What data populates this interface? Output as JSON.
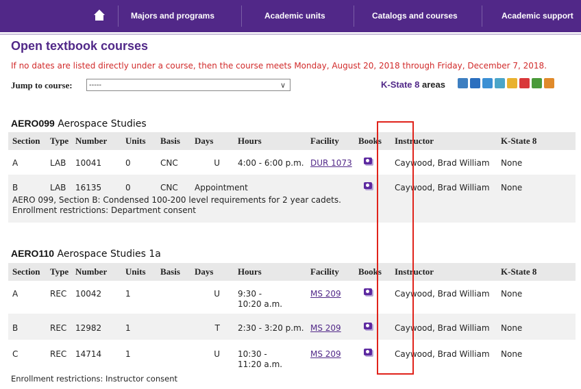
{
  "nav": {
    "items": [
      "Majors and programs",
      "Academic units",
      "Catalogs and courses",
      "Academic support"
    ],
    "home_icon": "home-icon",
    "bg_color": "#512888"
  },
  "page": {
    "title": "Open textbook courses",
    "notice": "If no dates are listed directly under a course, then the course meets Monday, August 20, 2018 through Friday, December 7, 2018.",
    "notice_color": "#d12a2a"
  },
  "jump": {
    "label": "Jump to course:",
    "selected": "-----"
  },
  "k8": {
    "label_brand": "K-State 8",
    "label_rest": " areas",
    "icons": [
      "aesthetic-icon",
      "empirical-icon",
      "ethical-icon",
      "global-icon",
      "historical-icon",
      "human-diversity-icon",
      "natural-physical-icon",
      "social-icon"
    ]
  },
  "columns": [
    "Section",
    "Type",
    "Number",
    "Units",
    "Basis",
    "Days",
    "Hours",
    "Facility",
    "Books",
    "Instructor",
    "K-State 8"
  ],
  "courses": [
    {
      "code": "AERO099",
      "name": "Aerospace Studies",
      "rows": [
        {
          "section": "A",
          "type": "LAB",
          "number": "10041",
          "units": "0",
          "basis": "CNC",
          "days": "U",
          "hours": "4:00 - 6:00 p.m.",
          "hours2": "",
          "facility": "DUR 1073",
          "instructor": "Caywood, Brad William",
          "k8": "None"
        },
        {
          "section": "B",
          "type": "LAB",
          "number": "16135",
          "units": "0",
          "basis": "CNC",
          "days": "Appointment",
          "hours": "",
          "hours2": "",
          "facility": "",
          "instructor": "Caywood, Brad William",
          "k8": "None"
        }
      ],
      "notes": [
        "AERO 099, Section B: Condensed 100-200 level requirements for 2 year cadets.",
        "Enrollment restrictions: Department consent"
      ]
    },
    {
      "code": "AERO110",
      "name": "Aerospace Studies 1a",
      "rows": [
        {
          "section": "A",
          "type": "REC",
          "number": "10042",
          "units": "1",
          "basis": "",
          "days": "U",
          "hours": "9:30 -",
          "hours2": "10:20 a.m.",
          "facility": "MS 209",
          "instructor": "Caywood, Brad William",
          "k8": "None"
        },
        {
          "section": "B",
          "type": "REC",
          "number": "12982",
          "units": "1",
          "basis": "",
          "days": "T",
          "hours": "2:30 - 3:20 p.m.",
          "hours2": "",
          "facility": "MS 209",
          "instructor": "Caywood, Brad William",
          "k8": "None"
        },
        {
          "section": "C",
          "type": "REC",
          "number": "14714",
          "units": "1",
          "basis": "",
          "days": "U",
          "hours": "10:30 -",
          "hours2": "11:20 a.m.",
          "facility": "MS 209",
          "instructor": "Caywood, Brad William",
          "k8": "None"
        }
      ],
      "notes": [
        "Enrollment restrictions: Instructor consent"
      ]
    }
  ]
}
